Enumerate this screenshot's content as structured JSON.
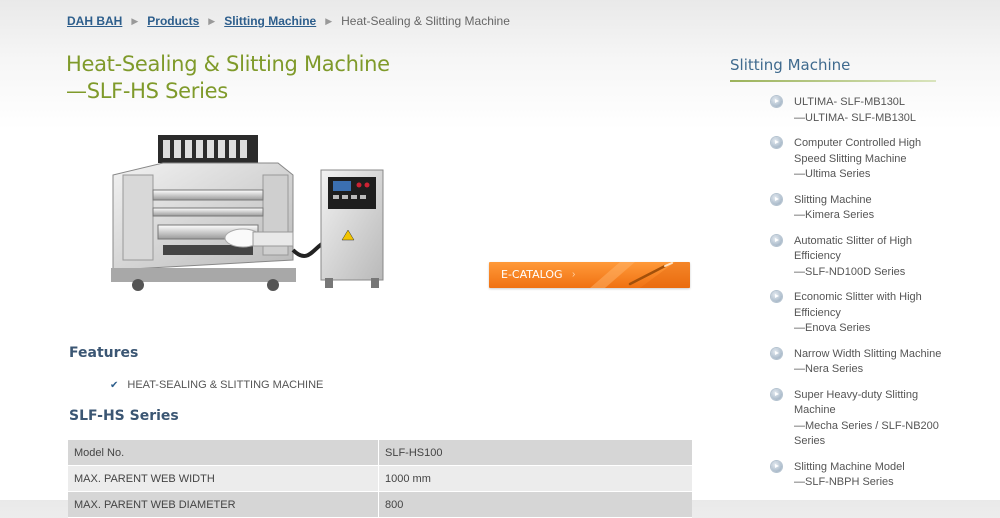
{
  "breadcrumb": {
    "home": "DAH BAH",
    "products": "Products",
    "category": "Slitting Machine",
    "current": "Heat-Sealing & Slitting Machine"
  },
  "page_title": {
    "line1": "Heat-Sealing & Slitting Machine",
    "line2": "—SLF-HS Series"
  },
  "ecatalog": {
    "label": "E-CATALOG",
    "arrow": "›"
  },
  "features": {
    "heading": "Features",
    "items": [
      "HEAT-SEALING & SLITTING MACHINE"
    ]
  },
  "series_heading": "SLF-HS Series",
  "spec_table": {
    "rows": [
      [
        "Model No.",
        "SLF-HS100"
      ],
      [
        "MAX. PARENT WEB WIDTH",
        "1000 mm"
      ],
      [
        "MAX. PARENT WEB DIAMETER",
        "800"
      ]
    ]
  },
  "sidebar": {
    "title": "Slitting Machine",
    "items": [
      {
        "lines": [
          "ULTIMA- SLF-MB130L",
          "—ULTIMA- SLF-MB130L"
        ]
      },
      {
        "lines": [
          "Computer Controlled High",
          "Speed Slitting Machine",
          "—Ultima Series"
        ]
      },
      {
        "lines": [
          "Slitting Machine",
          "—Kimera Series"
        ]
      },
      {
        "lines": [
          "Automatic Slitter of High",
          "Efficiency",
          "—SLF-ND100D Series"
        ]
      },
      {
        "lines": [
          "Economic Slitter with High",
          "Efficiency",
          "—Enova Series"
        ]
      },
      {
        "lines": [
          "Narrow Width Slitting Machine",
          "—Nera Series"
        ]
      },
      {
        "lines": [
          "Super Heavy-duty Slitting",
          "Machine",
          "—Mecha Series / SLF-NB200",
          "Series"
        ]
      },
      {
        "lines": [
          "Slitting Machine Model",
          "—SLF-NBPH Series"
        ]
      }
    ]
  },
  "colors": {
    "title_green": "#7f9a2a",
    "link_blue": "#2d5e8c",
    "heading_navy": "#3b5673",
    "ecatalog_orange": "#f07112"
  }
}
